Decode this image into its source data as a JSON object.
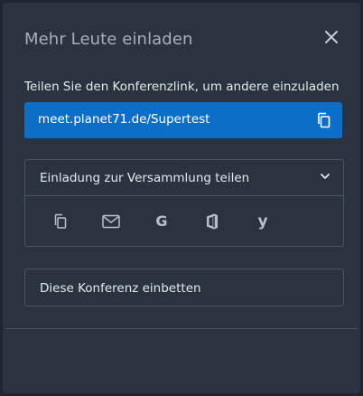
{
  "dialog": {
    "title": "Mehr Leute einladen",
    "close_icon": "close-icon"
  },
  "share_link": {
    "label": "Teilen Sie den Konferenzlink, um andere einzuladen",
    "url": "meet.planet71.de/Supertest",
    "copy_icon": "copy-icon"
  },
  "invite_section": {
    "label": "Einladung zur Versammlung teilen",
    "expand_icon": "chevron-down-icon",
    "share_icons": [
      "copy-icon",
      "email-icon",
      "google-icon",
      "office365-icon",
      "yahoo-icon"
    ]
  },
  "embed": {
    "label": "Diese Konferenz einbetten"
  },
  "colors": {
    "background": "#1d2733",
    "dialog": "#2a3441",
    "accent": "#0b6fc7",
    "border": "#4a5566",
    "text": "#e6e9ec",
    "muted": "#a6b0bc"
  }
}
